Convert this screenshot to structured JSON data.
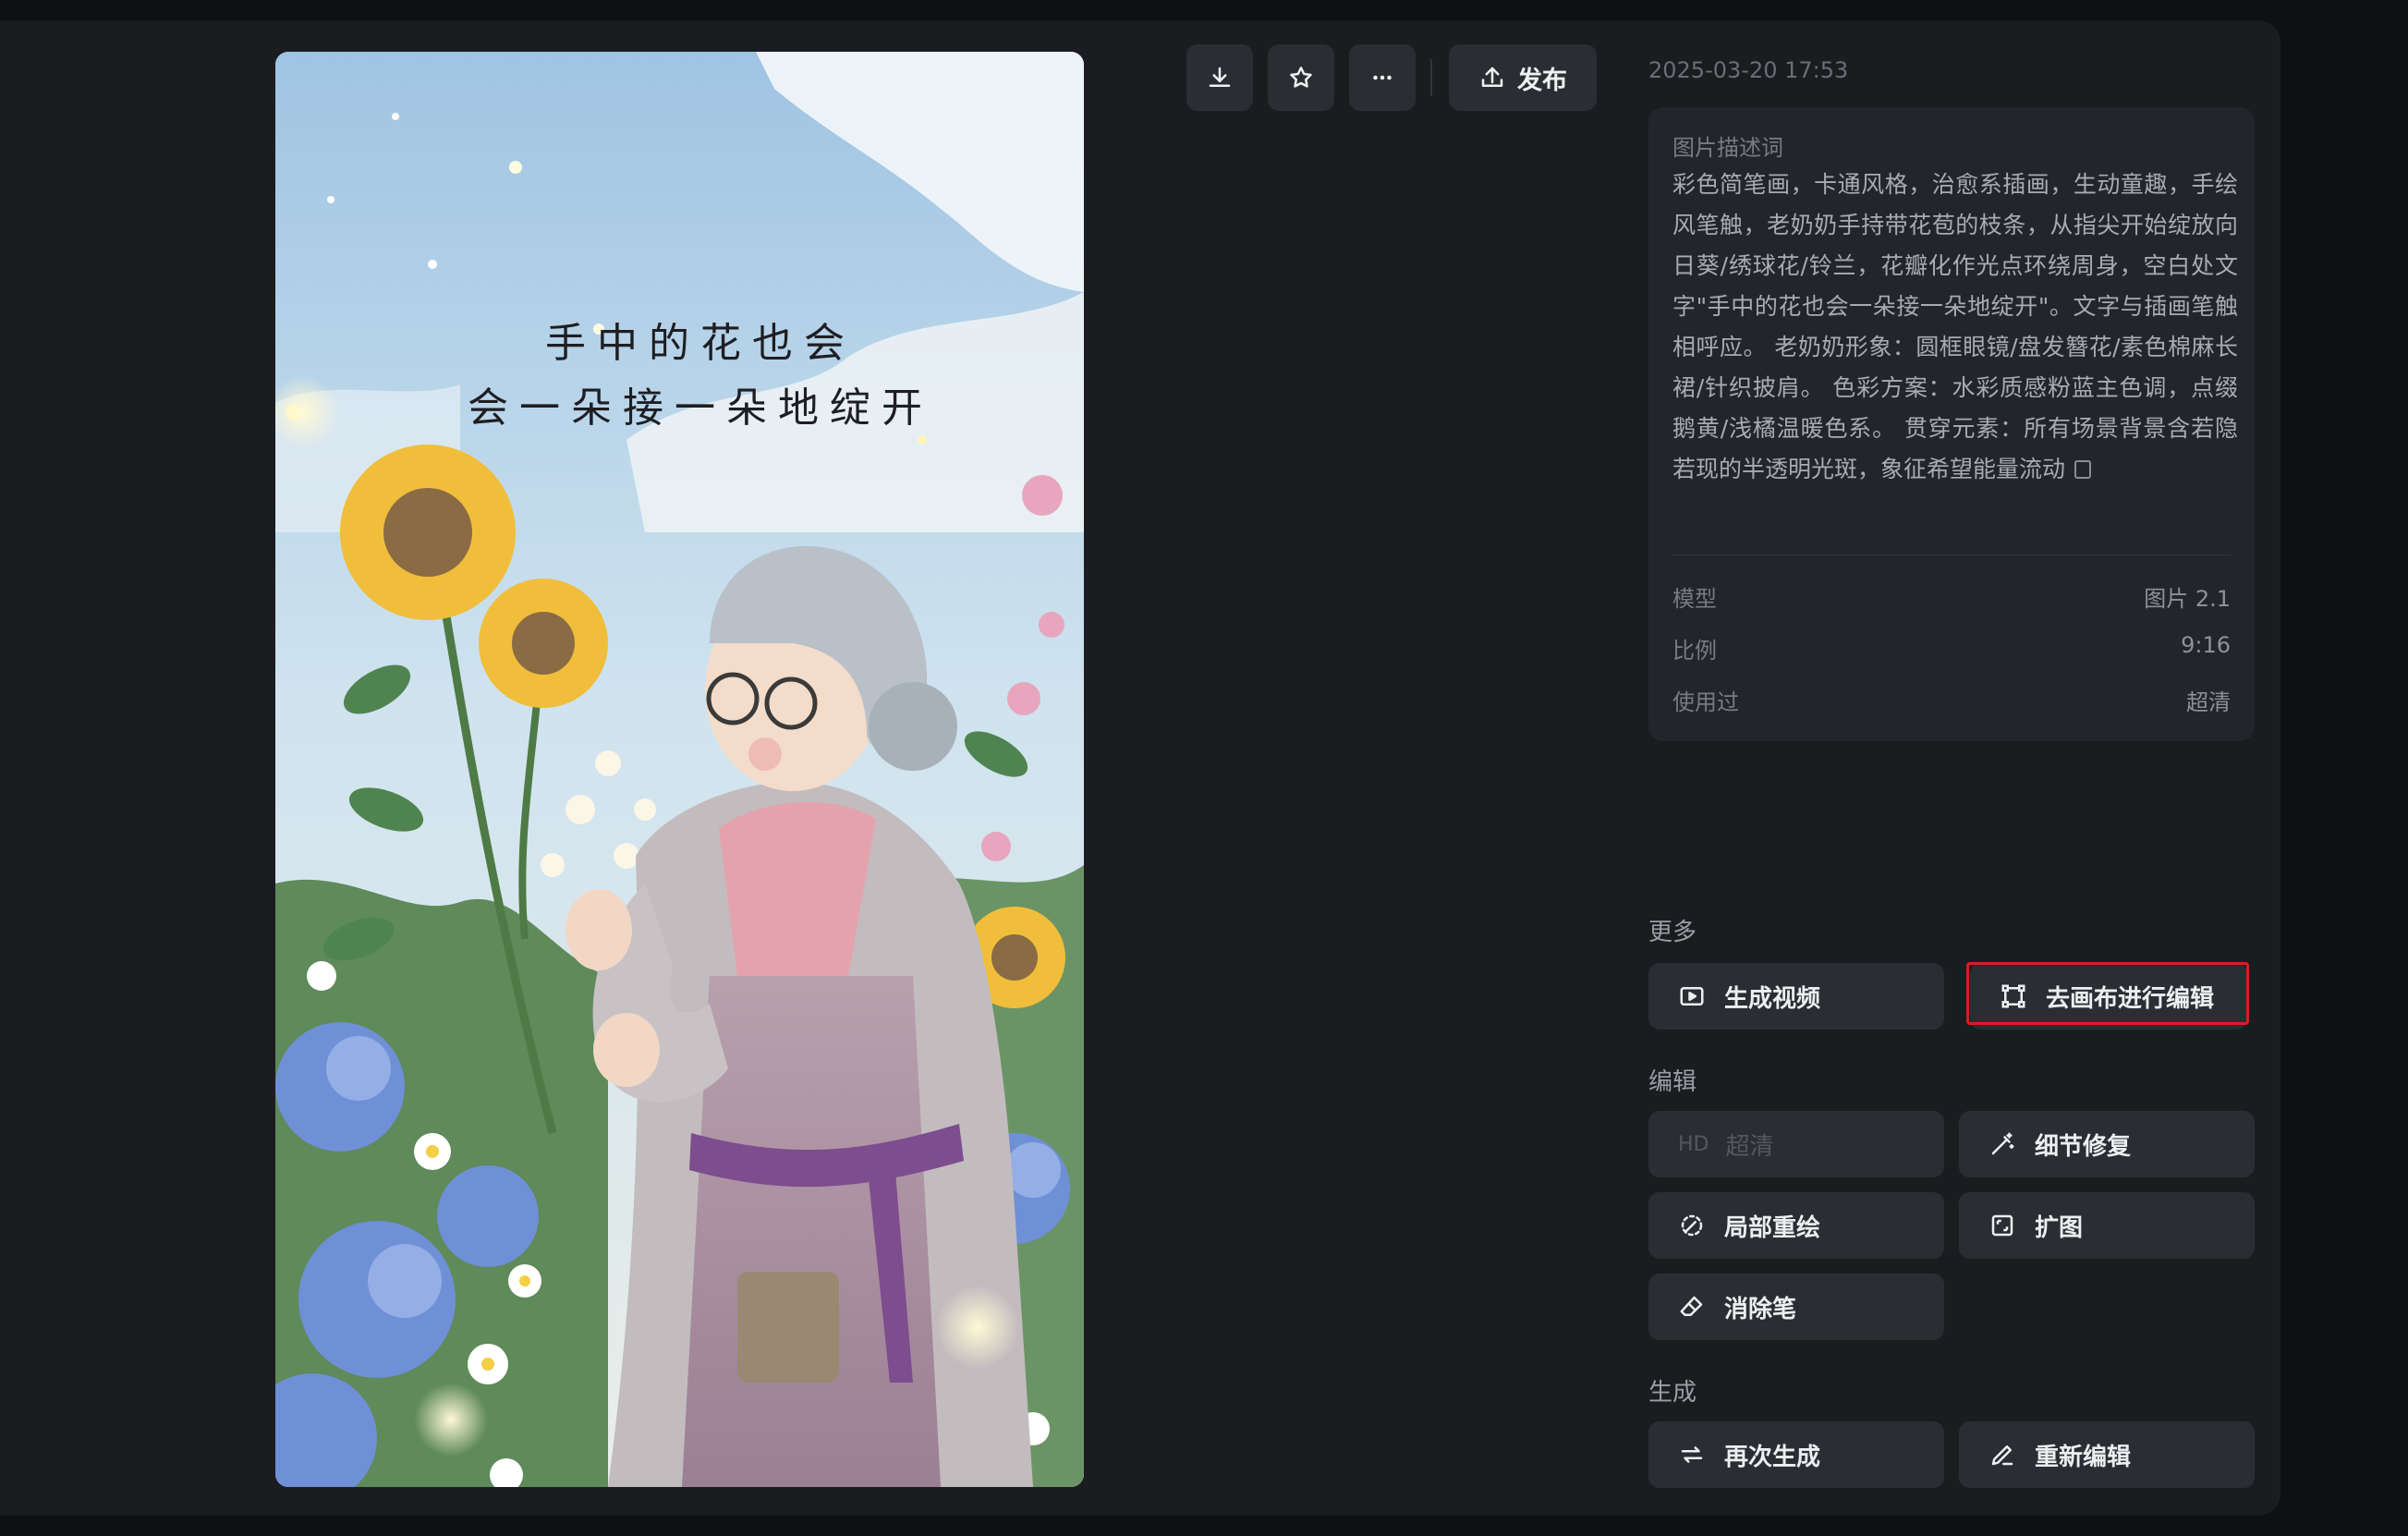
{
  "toolbar": {
    "download_icon": "download-icon",
    "favorite_icon": "star-icon",
    "more_icon": "more-horizontal-icon",
    "publish_label": "发布"
  },
  "image": {
    "caption_line1": "手中的花也会",
    "caption_line2": "会一朵接一朵地绽开"
  },
  "details": {
    "date": "2025-03-20 17:53",
    "prompt_label": "图片描述词",
    "prompt_text": "彩色简笔画，卡通风格，治愈系插画，生动童趣，手绘风笔触，老奶奶手持带花苞的枝条，从指尖开始绽放向日葵/绣球花/铃兰，花瓣化作光点环绕周身，空白处文字\"手中的花也会一朵接一朵地绽开\"。文字与插画笔触相呼应。 老奶奶形象：圆框眼镜/盘发簪花/素色棉麻长裙/针织披肩。 色彩方案：水彩质感粉蓝主色调，点缀鹅黄/浅橘温暖色系。 贯穿元素：所有场景背景含若隐若现的半透明光斑，象征希望能量流动",
    "rows": [
      {
        "label": "模型",
        "value": "图片 2.1"
      },
      {
        "label": "比例",
        "value": "9:16"
      },
      {
        "label": "使用过",
        "value": "超清"
      }
    ]
  },
  "sections": {
    "more": "更多",
    "edit": "编辑",
    "generate": "生成"
  },
  "actions": {
    "generate_video": "生成视频",
    "canvas_edit": "去画布进行编辑",
    "hd_badge": "HD",
    "upscale": "超清",
    "detail_fix": "细节修复",
    "inpaint": "局部重绘",
    "expand": "扩图",
    "eraser": "消除笔",
    "regenerate": "再次生成",
    "re_edit": "重新编辑"
  },
  "colors": {
    "background": "#0f1013",
    "panel": "#1b1c20",
    "card": "#24252b",
    "button": "#2c2d33",
    "highlight": "#d91e1e"
  }
}
